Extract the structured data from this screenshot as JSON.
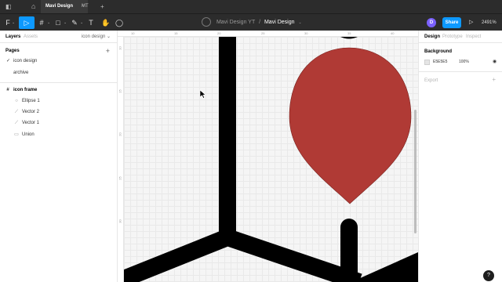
{
  "tabbar": {
    "active_tab": "Mavi Design",
    "active_tab_close": "×",
    "second_tab": "MT",
    "new_tab": "+",
    "home_icon": "⌂"
  },
  "toolbar": {
    "main_menu_icon": "F",
    "move_tool_icon": "▷",
    "frame_tool_icon": "#",
    "shape_tool_icon": "□",
    "pen_tool_icon": "✎",
    "text_tool_icon": "T",
    "hand_tool_icon": "✋",
    "comment_tool_icon": "◯",
    "caret": "⌄",
    "breadcrumb_team": "Mavi Design YT",
    "breadcrumb_sep": "/",
    "breadcrumb_file": "Mavi Design",
    "breadcrumb_caret": "⌄",
    "avatar_initial": "D",
    "share_label": "Share",
    "present_icon": "▷",
    "zoom_level": "2491%"
  },
  "left_panel": {
    "tab_layers": "Layers",
    "tab_assets": "Assets",
    "page_selector": "icon design ⌄",
    "pages_title": "Pages",
    "add_page": "+",
    "pages": [
      {
        "label": "icon design",
        "active": true,
        "check": "✓"
      },
      {
        "label": "archive",
        "active": false,
        "check": ""
      }
    ],
    "layers": [
      {
        "label": "icon frame",
        "icon": "#"
      },
      {
        "label": "Ellipse 1",
        "icon": "○"
      },
      {
        "label": "Vector 2",
        "icon": "⟋"
      },
      {
        "label": "Vector 1",
        "icon": "⟋"
      },
      {
        "label": "Union",
        "icon": "▭"
      }
    ]
  },
  "ruler": {
    "top": [
      "10",
      "15",
      "20",
      "25",
      "30",
      "35",
      "40"
    ],
    "left": [
      "10",
      "15",
      "20",
      "25",
      "30"
    ]
  },
  "right_panel": {
    "tab_design": "Design",
    "tab_prototype": "Prototype",
    "tab_inspect": "Inspect",
    "background_title": "Background",
    "background_hex": "E5E5E5",
    "background_opacity": "100%",
    "eye_icon": "◉",
    "export_label": "Export",
    "export_add": "+"
  },
  "colors": {
    "accent": "#0d99ff",
    "drop_fill": "#b03a35",
    "shape_fill": "#000000",
    "canvas_bg": "#f5f5f5"
  },
  "help_label": "?"
}
